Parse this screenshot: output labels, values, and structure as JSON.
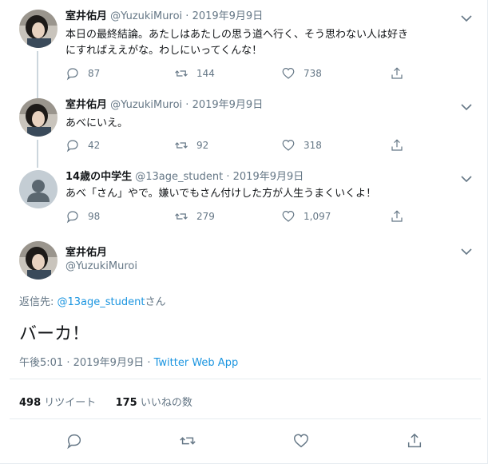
{
  "colors": {
    "link": "#1b95e0",
    "muted": "#657786",
    "text": "#14171a",
    "line": "#ccd6dd"
  },
  "tweets": [
    {
      "name": "室井佑月",
      "handle": "@YuzukiMuroi",
      "sep": "·",
      "date": "2019年9月9日",
      "text_lines": [
        "本日の最終結論。あたしはあたしの思う道へ行く、そう思わない人は好き",
        "にすればええがな。わしにいってくんな！"
      ],
      "replies": "87",
      "retweets": "144",
      "likes": "738",
      "avatar_icon": "profile-photo-icon"
    },
    {
      "name": "室井佑月",
      "handle": "@YuzukiMuroi",
      "sep": "·",
      "date": "2019年9月9日",
      "text_lines": [
        "あべにいえ。"
      ],
      "replies": "42",
      "retweets": "92",
      "likes": "318",
      "avatar_icon": "profile-photo-icon"
    },
    {
      "name": "14歳の中学生",
      "handle": "@13age_student",
      "sep": "·",
      "date": "2019年9月9日",
      "text_lines": [
        "あべ「さん」やで。嫌いでもさん付けした方が人生うまくいくよ！"
      ],
      "replies": "98",
      "retweets": "279",
      "likes": "1,097",
      "avatar_icon": "default-avatar-icon"
    }
  ],
  "main": {
    "name": "室井佑月",
    "handle": "@YuzukiMuroi",
    "reply_prefix": "返信先: ",
    "reply_mention": "@13age_student",
    "reply_suffix": "さん",
    "text": "バーカ！",
    "time": "午後5:01 · 2019年9月9日 · ",
    "via": "Twitter Web App",
    "retweet_count": "498",
    "retweet_label": " リツイート",
    "like_count": "175",
    "like_label": " いいねの数"
  }
}
